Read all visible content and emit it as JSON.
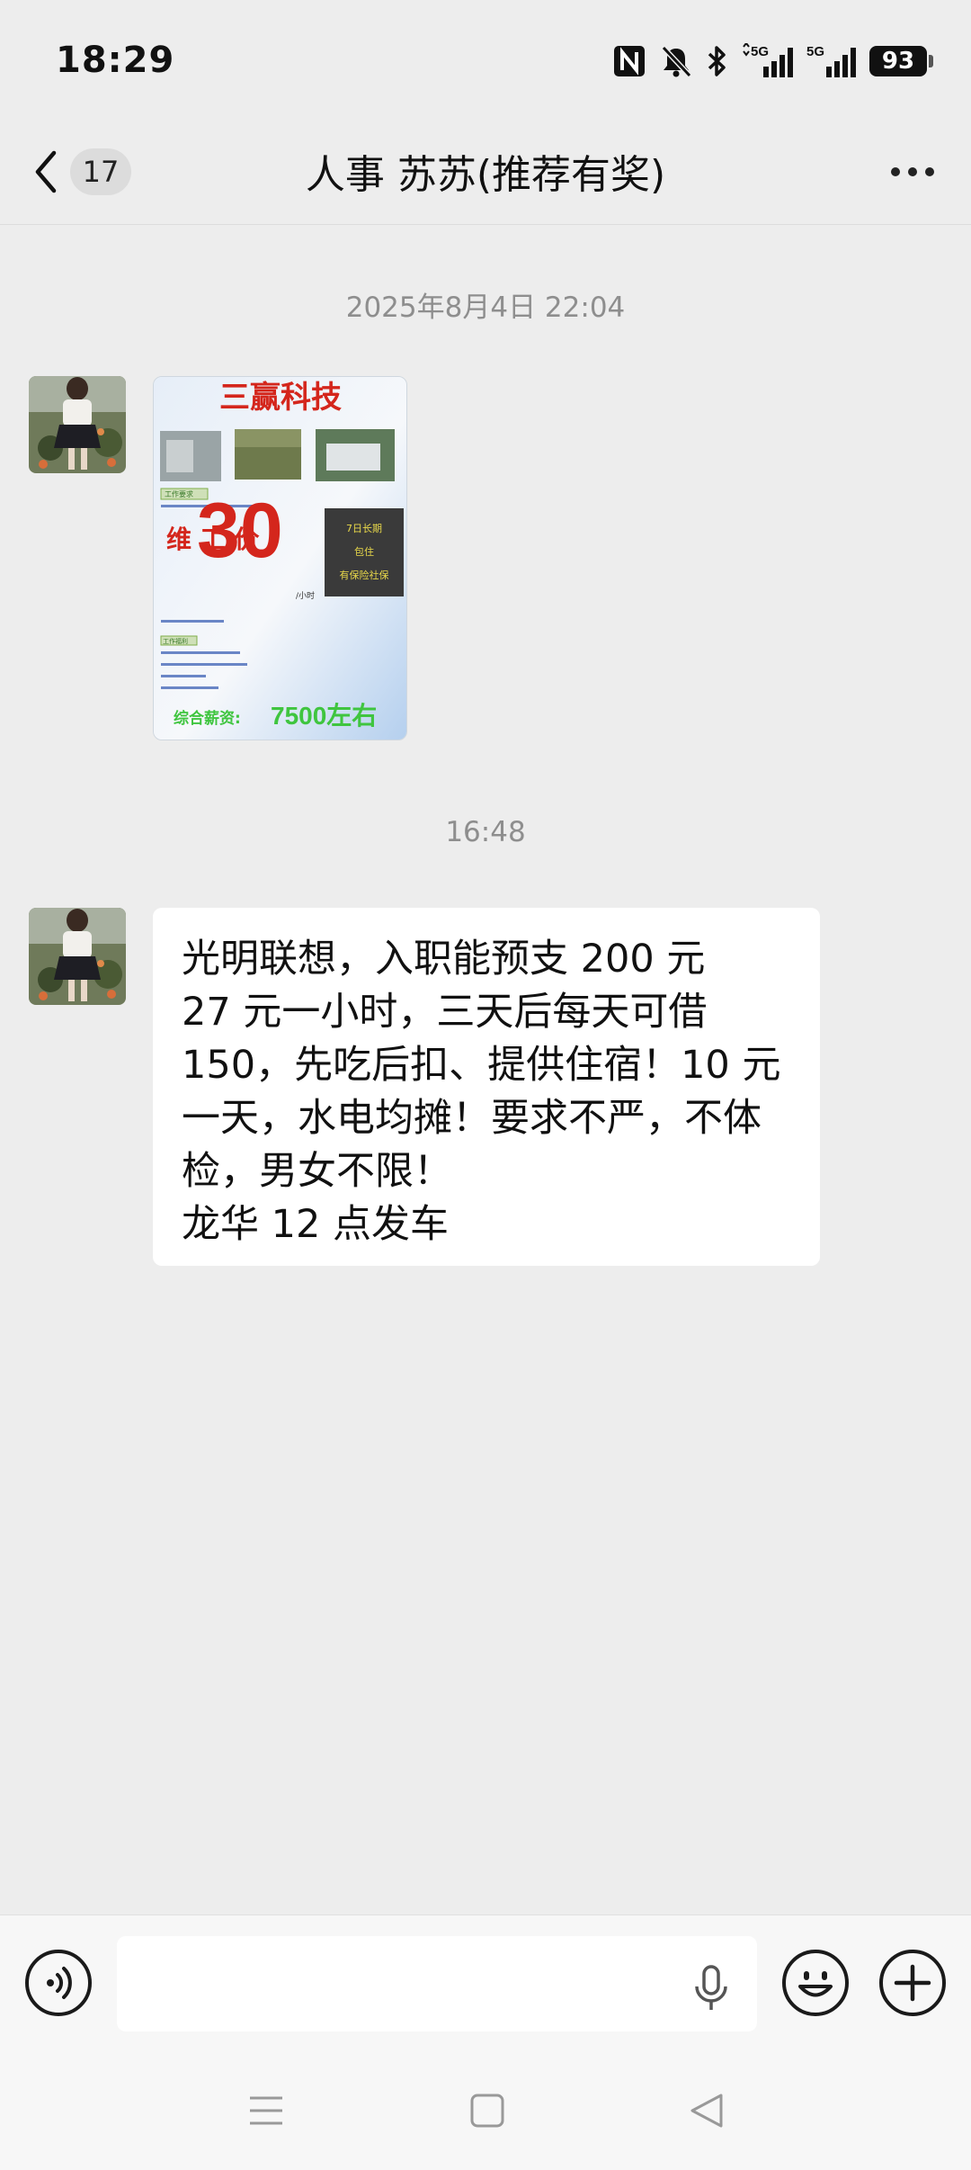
{
  "status_bar": {
    "time": "18:29",
    "signal_labels": [
      "5G",
      "5G"
    ],
    "battery": "93"
  },
  "header": {
    "back_icon": "chevron-left-icon",
    "unread_count": "17",
    "title": "人事 苏苏(推荐有奖)",
    "more_icon": "more-dots-icon"
  },
  "messages": [
    {
      "timestamp": "2025年8月4日 22:04",
      "type": "image",
      "poster": {
        "company": "三赢科技",
        "side_label": "维 工 价",
        "hourly_wage": "30",
        "wage_unit": "/小时",
        "perks": [
          "7日长期",
          "包住",
          "有保险社保"
        ],
        "tags": [
          "工作要求",
          "工作福利"
        ],
        "salary_label": "综合薪资:",
        "salary_value": "7500左右"
      }
    },
    {
      "timestamp": "16:48",
      "type": "text",
      "lines": [
        "光明联想，入职能预支 200 元",
        "27 元一小时，三天后每天可借",
        "150，先吃后扣、提供住宿！10 元",
        "一天，水电均摊！要求不严，不体",
        "检，男女不限！",
        "龙华 12 点发车"
      ]
    }
  ],
  "input_bar": {
    "voice_icon": "voice-mode-icon",
    "text_value": "",
    "mic_icon": "microphone-icon",
    "emoji_icon": "emoji-icon",
    "plus_icon": "plus-icon"
  },
  "nav_bar": {
    "icons": [
      "menu-icon",
      "home-icon",
      "back-triangle-icon"
    ]
  },
  "colors": {
    "background": "#ededed",
    "bubble": "#ffffff",
    "timestamp": "#8e8e8e",
    "poster_red": "#d4261c",
    "poster_green": "#3fc53f"
  }
}
